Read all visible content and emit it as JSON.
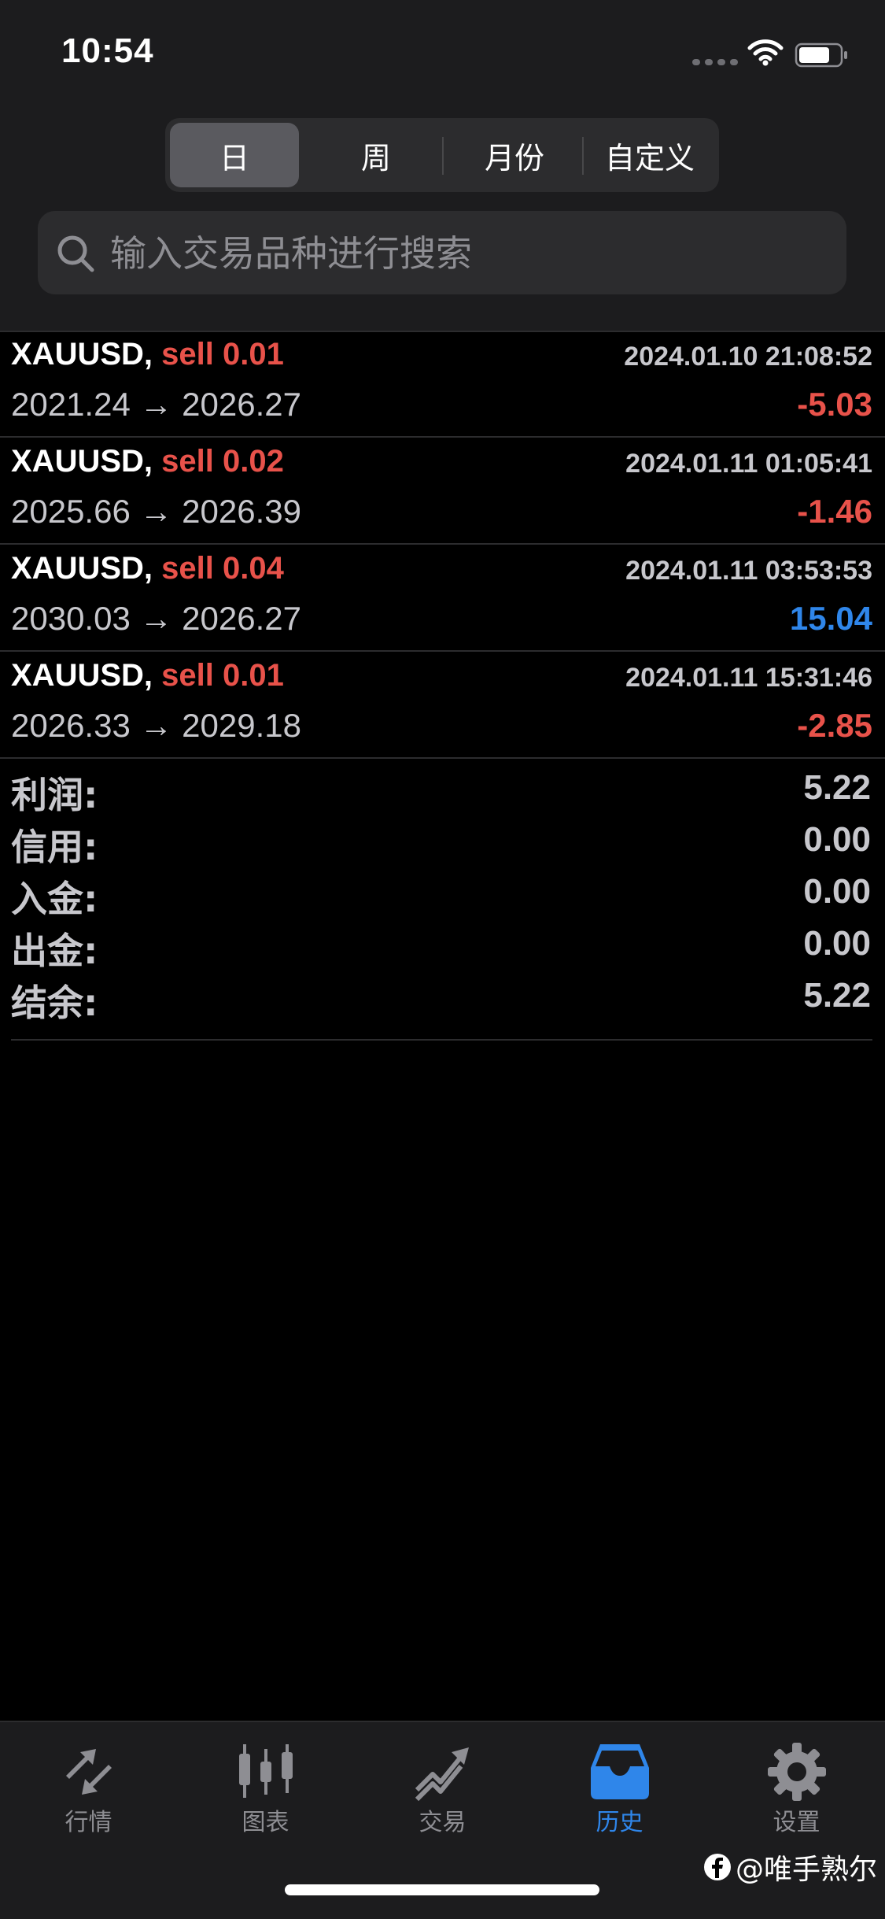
{
  "status_bar": {
    "time": "10:54"
  },
  "segments": [
    "日",
    "周",
    "月份",
    "自定义"
  ],
  "search": {
    "placeholder": "输入交易品种进行搜索"
  },
  "trades": [
    {
      "symbol": "XAUUSD,",
      "side": "sell 0.01",
      "time": "2024.01.10 21:08:52",
      "prices": "2021.24 → 2026.27",
      "profit": "-5.03"
    },
    {
      "symbol": "XAUUSD,",
      "side": "sell 0.02",
      "time": "2024.01.11 01:05:41",
      "prices": "2025.66 → 2026.39",
      "profit": "-1.46"
    },
    {
      "symbol": "XAUUSD,",
      "side": "sell 0.04",
      "time": "2024.01.11 03:53:53",
      "prices": "2030.03 → 2026.27",
      "profit": "15.04"
    },
    {
      "symbol": "XAUUSD,",
      "side": "sell 0.01",
      "time": "2024.01.11 15:31:46",
      "prices": "2026.33 → 2029.18",
      "profit": "-2.85"
    }
  ],
  "summary": [
    {
      "label": "利润:",
      "value": "5.22"
    },
    {
      "label": "信用:",
      "value": "0.00"
    },
    {
      "label": "入金:",
      "value": "0.00"
    },
    {
      "label": "出金:",
      "value": "0.00"
    },
    {
      "label": "结余:",
      "value": "5.22"
    }
  ],
  "tabs": [
    {
      "label": "行情",
      "icon": "quotes-icon"
    },
    {
      "label": "图表",
      "icon": "chart-candles-icon"
    },
    {
      "label": "交易",
      "icon": "trade-icon"
    },
    {
      "label": "历史",
      "icon": "history-inbox-icon"
    },
    {
      "label": "设置",
      "icon": "settings-gear-icon"
    }
  ],
  "watermark": "@唯手熟尔",
  "colors": {
    "negative": "#e8524a",
    "positive": "#2f86ea",
    "accent": "#2f86ea"
  }
}
